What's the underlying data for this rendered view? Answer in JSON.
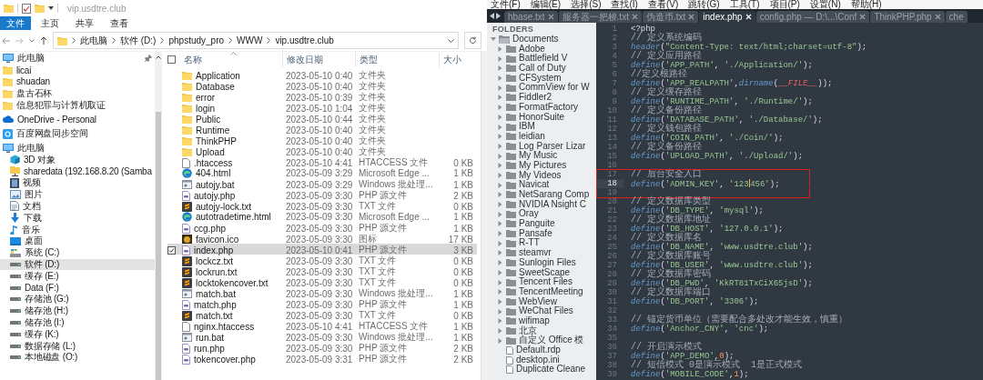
{
  "explorer": {
    "title": "vip.usdtre.club",
    "ribbon_tabs": [
      {
        "label": "文件",
        "selected": true
      },
      {
        "label": "主页",
        "selected": false
      },
      {
        "label": "共享",
        "selected": false
      },
      {
        "label": "查看",
        "selected": false
      }
    ],
    "breadcrumb": [
      "此电脑",
      "软件 (D:)",
      "phpstudy_pro",
      "WWW",
      "vip.usdtre.club"
    ],
    "nav": {
      "groups": [
        {
          "items": [
            {
              "label": "此电脑",
              "kind": "pc",
              "pinned": true,
              "selected": false
            },
            {
              "label": "licai",
              "kind": "folder",
              "pinned": false,
              "selected": false
            },
            {
              "label": "shuadan",
              "kind": "folder",
              "pinned": false,
              "selected": false
            },
            {
              "label": "盘古石杯",
              "kind": "folder",
              "pinned": false,
              "selected": false
            },
            {
              "label": "信息犯罪与计算机取证",
              "kind": "folder",
              "pinned": false,
              "selected": false
            }
          ]
        },
        {
          "items": [
            {
              "label": "OneDrive - Personal",
              "kind": "cloud",
              "pinned": false,
              "selected": false
            }
          ]
        },
        {
          "items": [
            {
              "label": "百度网盘同步空间",
              "kind": "sync",
              "pinned": false,
              "selected": false
            }
          ]
        },
        {
          "items": [
            {
              "label": "此电脑",
              "kind": "pc",
              "pinned": false,
              "selected": false,
              "children": [
                {
                  "label": "3D 对象",
                  "kind": "cube",
                  "selected": false
                },
                {
                  "label": "sharedata (192.168.8.20 (Samba",
                  "kind": "netdrive",
                  "selected": false
                },
                {
                  "label": "视频",
                  "kind": "video",
                  "selected": false
                },
                {
                  "label": "图片",
                  "kind": "picture",
                  "selected": false
                },
                {
                  "label": "文档",
                  "kind": "doc",
                  "selected": false
                },
                {
                  "label": "下载",
                  "kind": "download",
                  "selected": false
                },
                {
                  "label": "音乐",
                  "kind": "music",
                  "selected": false
                },
                {
                  "label": "桌面",
                  "kind": "desktop",
                  "selected": false
                },
                {
                  "label": "系统 (C:)",
                  "kind": "sysdrive",
                  "selected": false
                },
                {
                  "label": "软件 (D:)",
                  "kind": "drive",
                  "selected": true
                },
                {
                  "label": "缓存 (E:)",
                  "kind": "drive",
                  "selected": false
                },
                {
                  "label": "Data (F:)",
                  "kind": "drive",
                  "selected": false
                },
                {
                  "label": "存储池 (G:)",
                  "kind": "drive",
                  "selected": false
                },
                {
                  "label": "储存池 (H:)",
                  "kind": "drive",
                  "selected": false
                },
                {
                  "label": "储存池 (I:)",
                  "kind": "drive",
                  "selected": false
                },
                {
                  "label": "缓存 (K:)",
                  "kind": "drive",
                  "selected": false
                },
                {
                  "label": "数据存储 (L:)",
                  "kind": "drive",
                  "selected": false
                },
                {
                  "label": "本地磁盘 (O:)",
                  "kind": "drive",
                  "selected": false
                }
              ]
            }
          ]
        }
      ]
    },
    "select_all": {
      "checked": false
    },
    "columns": [
      "名称",
      "修改日期",
      "类型",
      "大小"
    ],
    "files": [
      {
        "name": "Application",
        "date": "2023-05-10 0:40",
        "type": "文件夹",
        "kind": "folder",
        "selected": false
      },
      {
        "name": "Database",
        "date": "2023-05-10 0:40",
        "type": "文件夹",
        "kind": "folder",
        "selected": false
      },
      {
        "name": "error",
        "date": "2023-05-10 0:39",
        "type": "文件夹",
        "kind": "folder",
        "selected": false
      },
      {
        "name": "login",
        "date": "2023-05-10 1:04",
        "type": "文件夹",
        "kind": "folder",
        "selected": false
      },
      {
        "name": "Public",
        "date": "2023-05-10 0:44",
        "type": "文件夹",
        "kind": "folder",
        "selected": false
      },
      {
        "name": "Runtime",
        "date": "2023-05-10 0:40",
        "type": "文件夹",
        "kind": "folder",
        "selected": false
      },
      {
        "name": "ThinkPHP",
        "date": "2023-05-10 0:40",
        "type": "文件夹",
        "kind": "folder",
        "selected": false
      },
      {
        "name": "Upload",
        "date": "2023-05-10 0:40",
        "type": "文件夹",
        "kind": "folder",
        "selected": false
      },
      {
        "name": ".htaccess",
        "date": "2023-05-10 4:41",
        "type": "HTACCESS 文件",
        "size": "0 KB",
        "kind": "file",
        "selected": false
      },
      {
        "name": "404.html",
        "date": "2023-05-09 3:29",
        "type": "Microsoft Edge ...",
        "size": "1 KB",
        "kind": "edge",
        "selected": false
      },
      {
        "name": "autojy.bat",
        "date": "2023-05-09 3:29",
        "type": "Windows 批处理...",
        "size": "1 KB",
        "kind": "bat",
        "selected": false
      },
      {
        "name": "autojy.php",
        "date": "2023-05-09 3:30",
        "type": "PHP 源文件",
        "size": "2 KB",
        "kind": "php",
        "selected": false
      },
      {
        "name": "autojy-lock.txt",
        "date": "2023-05-09 3:30",
        "type": "TXT 文件",
        "size": "0 KB",
        "kind": "txt",
        "selected": false
      },
      {
        "name": "autotradetime.html",
        "date": "2023-05-09 3:30",
        "type": "Microsoft Edge ...",
        "size": "1 KB",
        "kind": "edge",
        "selected": false
      },
      {
        "name": "ccg.php",
        "date": "2023-05-09 3:30",
        "type": "PHP 源文件",
        "size": "1 KB",
        "kind": "php",
        "selected": false
      },
      {
        "name": "favicon.ico",
        "date": "2023-05-09 3:30",
        "type": "图标",
        "size": "17 KB",
        "kind": "ico",
        "selected": false
      },
      {
        "name": "index.php",
        "date": "2023-05-10 0:41",
        "type": "PHP 源文件",
        "size": "3 KB",
        "kind": "php",
        "selected": true
      },
      {
        "name": "lockcz.txt",
        "date": "2023-05-09 3:30",
        "type": "TXT 文件",
        "size": "0 KB",
        "kind": "txt",
        "selected": false
      },
      {
        "name": "lockrun.txt",
        "date": "2023-05-09 3:30",
        "type": "TXT 文件",
        "size": "0 KB",
        "kind": "txt",
        "selected": false
      },
      {
        "name": "locktokencover.txt",
        "date": "2023-05-09 3:30",
        "type": "TXT 文件",
        "size": "0 KB",
        "kind": "txt",
        "selected": false
      },
      {
        "name": "match.bat",
        "date": "2023-05-09 3:30",
        "type": "Windows 批处理...",
        "size": "1 KB",
        "kind": "bat",
        "selected": false
      },
      {
        "name": "match.php",
        "date": "2023-05-09 3:30",
        "type": "PHP 源文件",
        "size": "1 KB",
        "kind": "php",
        "selected": false
      },
      {
        "name": "match.txt",
        "date": "2023-05-09 3:30",
        "type": "TXT 文件",
        "size": "0 KB",
        "kind": "txt",
        "selected": false
      },
      {
        "name": "nginx.htaccess",
        "date": "2023-05-10 4:41",
        "type": "HTACCESS 文件",
        "size": "1 KB",
        "kind": "file",
        "selected": false
      },
      {
        "name": "run.bat",
        "date": "2023-05-09 3:30",
        "type": "Windows 批处理...",
        "size": "1 KB",
        "kind": "bat",
        "selected": false
      },
      {
        "name": "run.php",
        "date": "2023-05-09 3:30",
        "type": "PHP 源文件",
        "size": "2 KB",
        "kind": "php",
        "selected": false
      },
      {
        "name": "tokencover.php",
        "date": "2023-05-09 3:31",
        "type": "PHP 源文件",
        "size": "2 KB",
        "kind": "php",
        "selected": false
      }
    ]
  },
  "editor": {
    "menu": [
      "文件(F)",
      "编辑(E)",
      "选择(S)",
      "查找(I)",
      "查看(V)",
      "跳转(G)",
      "工具(T)",
      "项目(P)",
      "设置(N)",
      "帮助(H)"
    ],
    "tabs": [
      {
        "label": "hbase.txt",
        "selected": false,
        "closable": true
      },
      {
        "label": "服务器一把梭.txt",
        "selected": false,
        "closable": true
      },
      {
        "label": "伪造币.txt",
        "selected": false,
        "closable": true
      },
      {
        "label": "index.php",
        "selected": true,
        "closable": true
      },
      {
        "label": "config.php — D:\\...\\Conf",
        "selected": false,
        "closable": true
      },
      {
        "label": "ThinkPHP.php",
        "selected": false,
        "closable": true
      },
      {
        "label": "che",
        "selected": false,
        "closable": false
      }
    ],
    "sidebar": {
      "header": "FOLDERS",
      "root": {
        "label": "Documents",
        "expanded": true,
        "children": [
          {
            "label": "Adobe",
            "kind": "folder",
            "expanded": false
          },
          {
            "label": "Battlefield V",
            "kind": "folder",
            "expanded": false
          },
          {
            "label": "Call of Duty",
            "kind": "folder",
            "expanded": false
          },
          {
            "label": "CFSystem",
            "kind": "folder",
            "expanded": false
          },
          {
            "label": "CommView for W",
            "kind": "folder",
            "expanded": false
          },
          {
            "label": "Fiddler2",
            "kind": "folder",
            "expanded": false
          },
          {
            "label": "FormatFactory",
            "kind": "folder",
            "expanded": false
          },
          {
            "label": "HonorSuite",
            "kind": "folder",
            "expanded": false
          },
          {
            "label": "IBM",
            "kind": "folder",
            "expanded": false
          },
          {
            "label": "leidian",
            "kind": "folder",
            "expanded": false
          },
          {
            "label": "Log Parser Lizar",
            "kind": "folder",
            "expanded": false
          },
          {
            "label": "My Music",
            "kind": "folder",
            "expanded": false
          },
          {
            "label": "My Pictures",
            "kind": "folder",
            "expanded": false
          },
          {
            "label": "My Videos",
            "kind": "folder",
            "expanded": false
          },
          {
            "label": "Navicat",
            "kind": "folder",
            "expanded": false
          },
          {
            "label": "NetSarang Comp",
            "kind": "folder",
            "expanded": false
          },
          {
            "label": "NVIDIA Nsight C",
            "kind": "folder",
            "expanded": false
          },
          {
            "label": "Oray",
            "kind": "folder",
            "expanded": false
          },
          {
            "label": "Panguite",
            "kind": "folder",
            "expanded": false
          },
          {
            "label": "Pansafe",
            "kind": "folder",
            "expanded": false
          },
          {
            "label": "R-TT",
            "kind": "folder",
            "expanded": false
          },
          {
            "label": "steamvr",
            "kind": "folder",
            "expanded": false
          },
          {
            "label": "Sunlogin Files",
            "kind": "folder",
            "expanded": false
          },
          {
            "label": "SweetScape",
            "kind": "folder",
            "expanded": false
          },
          {
            "label": "Tencent Files",
            "kind": "folder",
            "expanded": false
          },
          {
            "label": "TencentMeeting",
            "kind": "folder",
            "expanded": false
          },
          {
            "label": "WebView",
            "kind": "folder",
            "expanded": false
          },
          {
            "label": "WeChat Files",
            "kind": "folder",
            "expanded": false
          },
          {
            "label": "wifimap",
            "kind": "folder",
            "expanded": false
          },
          {
            "label": "北京",
            "kind": "folder",
            "expanded": false
          },
          {
            "label": "自定义 Office 模",
            "kind": "folder",
            "expanded": false
          },
          {
            "label": "Default.rdp",
            "kind": "file"
          },
          {
            "label": "desktop.ini",
            "kind": "file"
          },
          {
            "label": "Duplicate Cleane",
            "kind": "file"
          }
        ]
      }
    },
    "lines": [
      {
        "n": "1",
        "current": false,
        "framed": false,
        "tokens": [
          {
            "kind": "plain",
            "text": "<?php"
          }
        ]
      },
      {
        "n": "2",
        "current": false,
        "framed": false,
        "tokens": [
          {
            "kind": "comment",
            "text": "// 定义系统编码"
          }
        ]
      },
      {
        "n": "3",
        "current": false,
        "framed": false,
        "tokens": [
          {
            "kind": "fn",
            "text": "header"
          },
          {
            "kind": "punc",
            "text": "("
          },
          {
            "kind": "str",
            "text": "\"Content-Type: text/html;charset=utf-8\""
          },
          {
            "kind": "punc",
            "text": ");"
          }
        ]
      },
      {
        "n": "4",
        "current": false,
        "framed": false,
        "tokens": [
          {
            "kind": "comment",
            "text": "// 定义应用路径"
          }
        ]
      },
      {
        "n": "5",
        "current": false,
        "framed": false,
        "tokens": [
          {
            "kind": "fn",
            "text": "define"
          },
          {
            "kind": "punc",
            "text": "("
          },
          {
            "kind": "str",
            "text": "'APP_PATH'"
          },
          {
            "kind": "punc",
            "text": ", "
          },
          {
            "kind": "str",
            "text": "'./Application/'"
          },
          {
            "kind": "punc",
            "text": ");"
          }
        ]
      },
      {
        "n": "6",
        "current": false,
        "framed": false,
        "tokens": [
          {
            "kind": "comment",
            "text": "//定义根路径"
          }
        ]
      },
      {
        "n": "7",
        "current": false,
        "framed": false,
        "tokens": [
          {
            "kind": "fn",
            "text": "define"
          },
          {
            "kind": "punc",
            "text": "("
          },
          {
            "kind": "str",
            "text": "'APP_REALPATH'"
          },
          {
            "kind": "punc",
            "text": ","
          },
          {
            "kind": "fn",
            "text": "dirname"
          },
          {
            "kind": "punc",
            "text": "("
          },
          {
            "kind": "const",
            "text": "__FILE__"
          },
          {
            "kind": "punc",
            "text": "));"
          }
        ]
      },
      {
        "n": "8",
        "current": false,
        "framed": false,
        "tokens": [
          {
            "kind": "comment",
            "text": "// 定义缓存路径"
          }
        ]
      },
      {
        "n": "9",
        "current": false,
        "framed": false,
        "tokens": [
          {
            "kind": "fn",
            "text": "define"
          },
          {
            "kind": "punc",
            "text": "("
          },
          {
            "kind": "str",
            "text": "'RUNTIME_PATH'"
          },
          {
            "kind": "punc",
            "text": ", "
          },
          {
            "kind": "str",
            "text": "'./Runtime/'"
          },
          {
            "kind": "punc",
            "text": ");"
          }
        ]
      },
      {
        "n": "10",
        "current": false,
        "framed": false,
        "tokens": [
          {
            "kind": "comment",
            "text": "// 定义备份路径"
          }
        ]
      },
      {
        "n": "11",
        "current": false,
        "framed": false,
        "tokens": [
          {
            "kind": "fn",
            "text": "define"
          },
          {
            "kind": "punc",
            "text": "("
          },
          {
            "kind": "str",
            "text": "'DATABASE_PATH'"
          },
          {
            "kind": "punc",
            "text": ", "
          },
          {
            "kind": "str",
            "text": "'./Database/'"
          },
          {
            "kind": "punc",
            "text": ");"
          }
        ]
      },
      {
        "n": "12",
        "current": false,
        "framed": false,
        "tokens": [
          {
            "kind": "comment",
            "text": "// 定义钱包路径"
          }
        ]
      },
      {
        "n": "13",
        "current": false,
        "framed": false,
        "tokens": [
          {
            "kind": "fn",
            "text": "define"
          },
          {
            "kind": "punc",
            "text": "("
          },
          {
            "kind": "str",
            "text": "'COIN_PATH'"
          },
          {
            "kind": "punc",
            "text": ", "
          },
          {
            "kind": "str",
            "text": "'./Coin/'"
          },
          {
            "kind": "punc",
            "text": ");"
          }
        ]
      },
      {
        "n": "14",
        "current": false,
        "framed": false,
        "tokens": [
          {
            "kind": "comment",
            "text": "// 定义备份路径"
          }
        ]
      },
      {
        "n": "15",
        "current": false,
        "framed": false,
        "tokens": [
          {
            "kind": "fn",
            "text": "define"
          },
          {
            "kind": "punc",
            "text": "("
          },
          {
            "kind": "str",
            "text": "'UPLOAD_PATH'"
          },
          {
            "kind": "punc",
            "text": ", "
          },
          {
            "kind": "str",
            "text": "'./Upload/'"
          },
          {
            "kind": "punc",
            "text": ");"
          }
        ]
      },
      {
        "n": "16",
        "current": false,
        "framed": false
      },
      {
        "n": "17",
        "current": false,
        "framed": true,
        "tokens": [
          {
            "kind": "comment",
            "text": "// 后台安全入口"
          }
        ]
      },
      {
        "n": "18",
        "current": true,
        "framed": true,
        "tokens": [
          {
            "kind": "fn",
            "text": "define"
          },
          {
            "kind": "punc",
            "text": "("
          },
          {
            "kind": "str",
            "text": "'ADMIN_KEY'"
          },
          {
            "kind": "punc",
            "text": ", "
          },
          {
            "kind": "str",
            "text": "'123"
          },
          {
            "kind": "caret"
          },
          {
            "kind": "str",
            "text": "456'"
          },
          {
            "kind": "punc",
            "text": ");"
          }
        ]
      },
      {
        "n": "19",
        "current": false,
        "framed": true
      },
      {
        "n": "20",
        "current": false,
        "framed": false,
        "tokens": [
          {
            "kind": "comment",
            "text": "// 定义数据库类型"
          }
        ]
      },
      {
        "n": "21",
        "current": false,
        "framed": false,
        "tokens": [
          {
            "kind": "fn",
            "text": "define"
          },
          {
            "kind": "punc",
            "text": "("
          },
          {
            "kind": "str",
            "text": "'DB_TYPE'"
          },
          {
            "kind": "punc",
            "text": ", "
          },
          {
            "kind": "str",
            "text": "'mysql'"
          },
          {
            "kind": "punc",
            "text": ");"
          }
        ]
      },
      {
        "n": "22",
        "current": false,
        "framed": false,
        "tokens": [
          {
            "kind": "comment",
            "text": "// 定义数据库地址"
          }
        ]
      },
      {
        "n": "23",
        "current": false,
        "framed": false,
        "tokens": [
          {
            "kind": "fn",
            "text": "define"
          },
          {
            "kind": "punc",
            "text": "("
          },
          {
            "kind": "str",
            "text": "'DB_HOST'"
          },
          {
            "kind": "punc",
            "text": ", "
          },
          {
            "kind": "str",
            "text": "'127.0.0.1'"
          },
          {
            "kind": "punc",
            "text": ");"
          }
        ]
      },
      {
        "n": "24",
        "current": false,
        "framed": false,
        "tokens": [
          {
            "kind": "comment",
            "text": "// 定义数据库名"
          }
        ]
      },
      {
        "n": "25",
        "current": false,
        "framed": false,
        "tokens": [
          {
            "kind": "fn",
            "text": "define"
          },
          {
            "kind": "punc",
            "text": "("
          },
          {
            "kind": "str",
            "text": "'DB_NAME'"
          },
          {
            "kind": "punc",
            "text": ", "
          },
          {
            "kind": "str",
            "text": "'www.usdtre.club'"
          },
          {
            "kind": "punc",
            "text": ");"
          }
        ]
      },
      {
        "n": "26",
        "current": false,
        "framed": false,
        "tokens": [
          {
            "kind": "comment",
            "text": "// 定义数据库账号"
          }
        ]
      },
      {
        "n": "27",
        "current": false,
        "framed": false,
        "tokens": [
          {
            "kind": "fn",
            "text": "define"
          },
          {
            "kind": "punc",
            "text": "("
          },
          {
            "kind": "str",
            "text": "'DB_USER'"
          },
          {
            "kind": "punc",
            "text": ", "
          },
          {
            "kind": "str",
            "text": "'www.usdtre.club'"
          },
          {
            "kind": "punc",
            "text": ");"
          }
        ]
      },
      {
        "n": "28",
        "current": false,
        "framed": false,
        "tokens": [
          {
            "kind": "comment",
            "text": "// 定义数据库密码"
          }
        ]
      },
      {
        "n": "29",
        "current": false,
        "framed": false,
        "tokens": [
          {
            "kind": "fn",
            "text": "define"
          },
          {
            "kind": "punc",
            "text": "("
          },
          {
            "kind": "str",
            "text": "'DB_PWD'"
          },
          {
            "kind": "punc",
            "text": ", "
          },
          {
            "kind": "str",
            "text": "'KkRT81TxCiX65jsD'"
          },
          {
            "kind": "punc",
            "text": ");"
          }
        ]
      },
      {
        "n": "30",
        "current": false,
        "framed": false,
        "tokens": [
          {
            "kind": "comment",
            "text": "// 定义数据库端口"
          }
        ]
      },
      {
        "n": "31",
        "current": false,
        "framed": false,
        "tokens": [
          {
            "kind": "fn",
            "text": "define"
          },
          {
            "kind": "punc",
            "text": "("
          },
          {
            "kind": "str",
            "text": "'DB_PORT'"
          },
          {
            "kind": "punc",
            "text": ", "
          },
          {
            "kind": "str",
            "text": "'3306'"
          },
          {
            "kind": "punc",
            "text": ");"
          }
        ]
      },
      {
        "n": "32",
        "current": false,
        "framed": false
      },
      {
        "n": "33",
        "current": false,
        "framed": false,
        "tokens": [
          {
            "kind": "comment",
            "text": "// 锚定货币单位（需要配合多处改才能生效，慎重）"
          }
        ]
      },
      {
        "n": "34",
        "current": false,
        "framed": false,
        "tokens": [
          {
            "kind": "fn",
            "text": "define"
          },
          {
            "kind": "punc",
            "text": "("
          },
          {
            "kind": "str",
            "text": "'Anchor_CNY'"
          },
          {
            "kind": "punc",
            "text": ", "
          },
          {
            "kind": "str",
            "text": "'cnc'"
          },
          {
            "kind": "punc",
            "text": ");"
          }
        ]
      },
      {
        "n": "35",
        "current": false,
        "framed": false
      },
      {
        "n": "36",
        "current": false,
        "framed": false,
        "tokens": [
          {
            "kind": "comment",
            "text": "// 开启演示模式"
          }
        ]
      },
      {
        "n": "37",
        "current": false,
        "framed": false,
        "tokens": [
          {
            "kind": "fn",
            "text": "define"
          },
          {
            "kind": "punc",
            "text": "("
          },
          {
            "kind": "str",
            "text": "'APP_DEMO'"
          },
          {
            "kind": "punc",
            "text": ","
          },
          {
            "kind": "num",
            "text": "0"
          },
          {
            "kind": "punc",
            "text": ");"
          }
        ]
      },
      {
        "n": "38",
        "current": false,
        "framed": false,
        "tokens": [
          {
            "kind": "comment",
            "text": "// 短信模式 0是演示模式  1是正式模式"
          }
        ]
      },
      {
        "n": "39",
        "current": false,
        "framed": false,
        "tokens": [
          {
            "kind": "fn",
            "text": "define"
          },
          {
            "kind": "punc",
            "text": "("
          },
          {
            "kind": "str",
            "text": "'MOBILE_CODE'"
          },
          {
            "kind": "punc",
            "text": ","
          },
          {
            "kind": "num",
            "text": "1"
          },
          {
            "kind": "punc",
            "text": ");"
          }
        ]
      }
    ]
  }
}
